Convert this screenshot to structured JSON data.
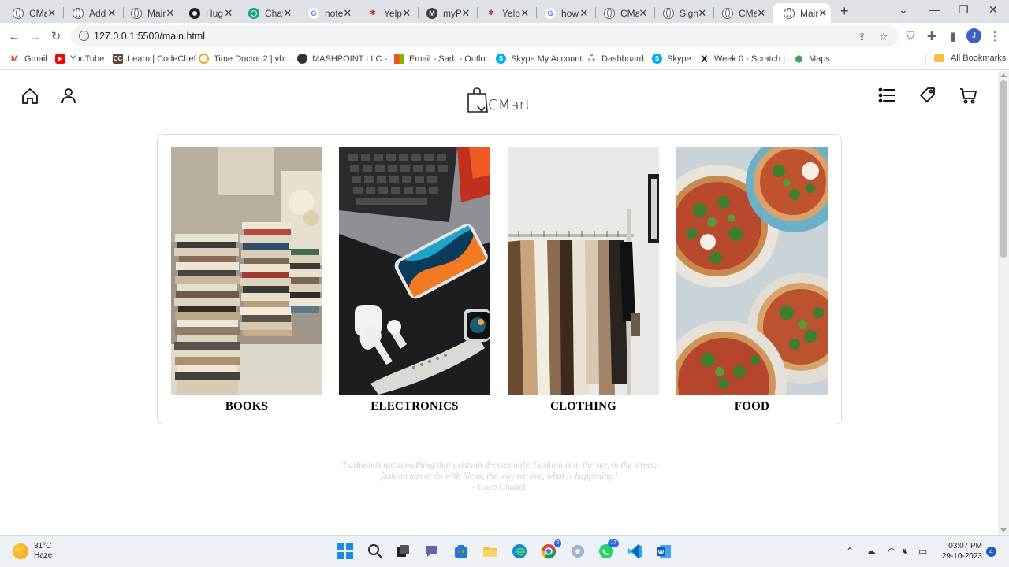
{
  "browser": {
    "tabs": [
      {
        "title": "CMart",
        "favicon": "globe-icon"
      },
      {
        "title": "Add",
        "favicon": "globe-icon"
      },
      {
        "title": "Main",
        "favicon": "globe-icon"
      },
      {
        "title": "Hug",
        "favicon": "github-icon"
      },
      {
        "title": "Chat",
        "favicon": "chatgpt-icon"
      },
      {
        "title": "note",
        "favicon": "google-icon"
      },
      {
        "title": "Yelp",
        "favicon": "yelp-icon"
      },
      {
        "title": "myP",
        "favicon": "myp-icon"
      },
      {
        "title": "Yelp",
        "favicon": "yelp-icon"
      },
      {
        "title": "how",
        "favicon": "google-icon"
      },
      {
        "title": "CMart",
        "favicon": "globe-icon"
      },
      {
        "title": "Sign",
        "favicon": "globe-icon"
      },
      {
        "title": "CMart",
        "favicon": "globe-icon"
      },
      {
        "title": "Main",
        "favicon": "globe-icon",
        "active": true
      }
    ],
    "url": "127.0.0.1:5500/main.html",
    "profile_initial": "J",
    "bookmarks": [
      {
        "label": "Gmail",
        "icon": "gmail-icon",
        "color": "#ea4335"
      },
      {
        "label": "YouTube",
        "icon": "youtube-icon",
        "color": "#ff0000"
      },
      {
        "label": "Learn | CodeChef",
        "icon": "codechef-icon",
        "color": "#5b4638"
      },
      {
        "label": "Time Doctor 2 | vbr...",
        "icon": "timedoctor-icon",
        "color": "#f5a623"
      },
      {
        "label": "MASHPOINT LLC -...",
        "icon": "mashpoint-icon",
        "color": "#333333"
      },
      {
        "label": "Email - Sarb - Outlo...",
        "icon": "microsoft-icon",
        "color": "#f25022"
      },
      {
        "label": "Skype My Account",
        "icon": "skype-icon",
        "color": "#00aff0"
      },
      {
        "label": "Dashboard",
        "icon": "dashboard-icon",
        "color": "#b5651d"
      },
      {
        "label": "Skype",
        "icon": "skype-icon",
        "color": "#00aff0"
      },
      {
        "label": "Week 0 - Scratch |...",
        "icon": "x-icon",
        "color": "#111111"
      },
      {
        "label": "Maps",
        "icon": "maps-icon",
        "color": "#34a853"
      }
    ],
    "all_bookmarks_label": "All Bookmarks"
  },
  "site": {
    "logo_text": "CMart",
    "header_icons_left": [
      "home-icon",
      "user-icon"
    ],
    "header_icons_right": [
      "menu-list-icon",
      "tag-icon",
      "cart-icon"
    ],
    "categories": [
      {
        "label": "BOOKS",
        "image": "stacked books beside a window"
      },
      {
        "label": "ELECTRONICS",
        "image": "laptop, phone, earbuds and smartwatch"
      },
      {
        "label": "CLOTHING",
        "image": "clothes hanging on a rail"
      },
      {
        "label": "FOOD",
        "image": "pizzas topped with arugula"
      }
    ],
    "quote": {
      "line1": "'Fashion is not something that exists in dresses only. Fashion is in the sky, in the street;",
      "line2": "fashion has to do with ideas, the way we live, what is happening.'",
      "author": "- Coco Chanel"
    }
  },
  "taskbar": {
    "weather_temp": "31°C",
    "weather_desc": "Haze",
    "time": "03:07 PM",
    "date": "29-10-2023",
    "notification_count": "4",
    "whatsapp_badge": "17",
    "chrome_badge": "J"
  }
}
